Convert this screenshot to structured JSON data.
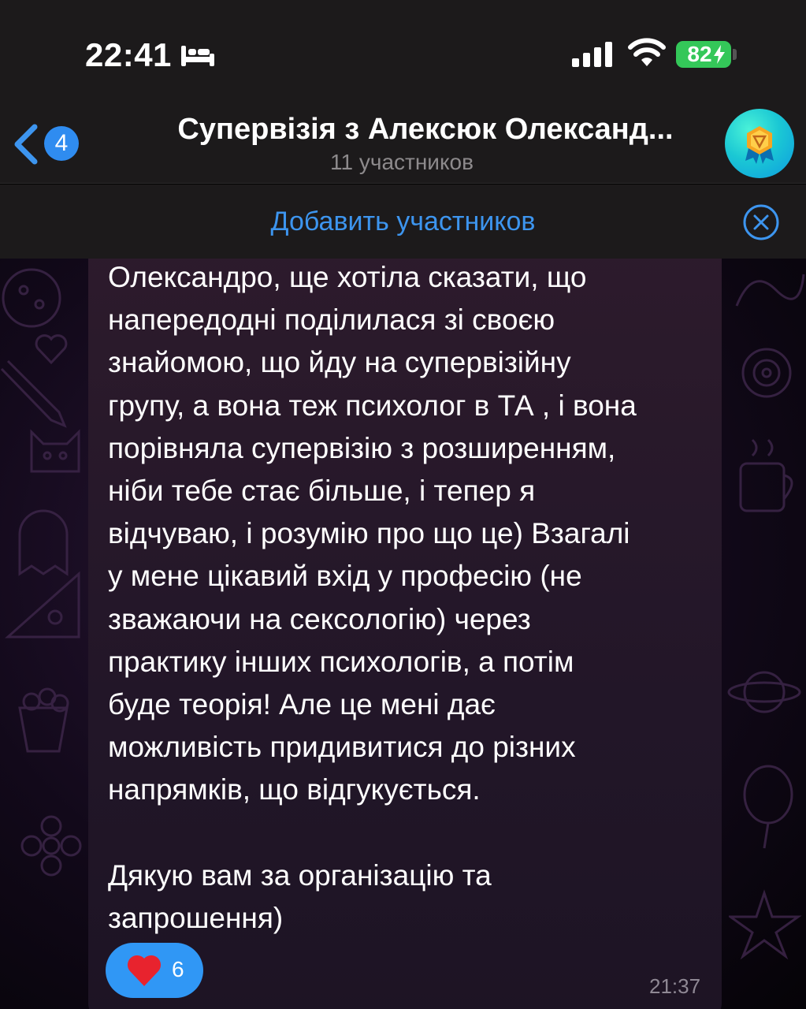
{
  "status_bar": {
    "time": "22:41",
    "battery_percent": "82",
    "icons": [
      "bed-icon",
      "signal-icon",
      "wifi-icon",
      "battery-icon"
    ]
  },
  "header": {
    "back_count": "4",
    "title": "Супервізія з Алексюк Олександ...",
    "subtitle": "11 участников",
    "avatar_icon": "award-emblem-icon"
  },
  "add_members": {
    "label": "Добавить участников",
    "close_icon": "close-circle-icon"
  },
  "message": {
    "lines": [
      "Олександро, ще хотіла сказати, що",
      "напередодні поділилася зі своєю",
      "знайомою, що йду на супервізійну",
      "групу, а вона теж психолог в ТА , і вона",
      "порівняла супервізію з розширенням,",
      "ніби тебе стає більше, і тепер я",
      "відчуваю, і розумію про що це) Взагалі",
      "у мене цікавий вхід у професію (не",
      "зважаючи на сексологію) через",
      "практику інших психологів, а потім",
      "буде теорія! Але це мені дає",
      "можливість придивитися до різних",
      "напрямків, що відгукується."
    ],
    "lines_after_gap": [
      "Дякую вам за організацію та",
      "запрошення)"
    ],
    "reaction": {
      "emoji": "heart-icon",
      "count": "6"
    },
    "time": "21:37"
  },
  "colors": {
    "accent_blue": "#3d95ef",
    "badge_blue": "#2f8cf0",
    "reaction_blue": "#3097f5",
    "battery_green": "#34c759",
    "header_bg": "#1c1a1b",
    "bubble_bg": "#2a1a2c"
  }
}
